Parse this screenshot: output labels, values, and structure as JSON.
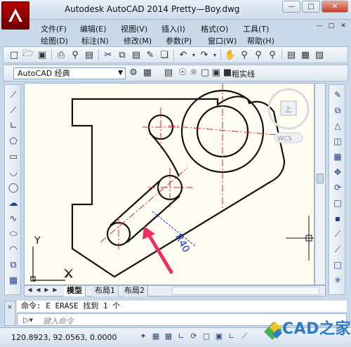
{
  "window": {
    "app_title": "Autodesk AutoCAD 2014",
    "file_name": "Pretty—Boy.dwg",
    "min_glyph": "—",
    "max_glyph": "□",
    "close_glyph": "✕"
  },
  "menu": {
    "row1": [
      "文件(F)",
      "编辑(E)",
      "视图(V)",
      "插入(I)",
      "格式(O)",
      "工具(T)"
    ],
    "row2": [
      "绘图(D)",
      "标注(N)",
      "修改(M)",
      "参数(P)",
      "窗口(W)",
      "帮助(H)"
    ],
    "mdi": [
      "—",
      "□",
      "✕"
    ]
  },
  "toolbar2": {
    "workspace": "AutoCAD 经典",
    "layer_name": "粗实线"
  },
  "viewcube": {
    "compass_letter": "上",
    "wcs_label": "WCS"
  },
  "drawing": {
    "dimension_text": "R40",
    "ucs_y": "Y",
    "ucs_x": "X"
  },
  "tabs": {
    "items": [
      "模型",
      "布局1",
      "布局2"
    ],
    "active": "模型"
  },
  "command": {
    "history": "命令: E ERASE 找到 1 个",
    "placeholder": "键入命令"
  },
  "status": {
    "coordinates": "120.8923, 92.0563, 0.0000"
  },
  "watermark": {
    "text": "CAD之家"
  },
  "colors": {
    "title_gradient": "#e6eef8",
    "drawing_bg": "#fffdf2",
    "centerline": "#e02424",
    "dimension": "#2233cc",
    "arrow": "#ee2e66",
    "app_button": "#b80000"
  }
}
